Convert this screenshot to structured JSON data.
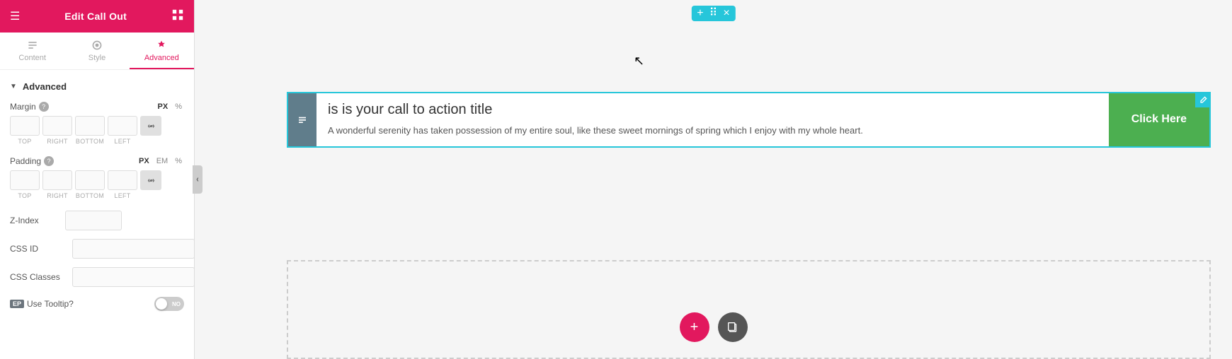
{
  "panel": {
    "header": {
      "title": "Edit Call Out",
      "hamburger": "☰",
      "grid": "⊞"
    },
    "tabs": [
      {
        "id": "content",
        "label": "Content",
        "icon": "content"
      },
      {
        "id": "style",
        "label": "Style",
        "icon": "style"
      },
      {
        "id": "advanced",
        "label": "Advanced",
        "icon": "advanced",
        "active": true
      }
    ],
    "advanced": {
      "section_title": "Advanced",
      "margin": {
        "label": "Margin",
        "units": [
          "PX",
          "%"
        ],
        "active_unit": "PX",
        "top": "",
        "right": "",
        "bottom": "",
        "left": "",
        "sub_labels": [
          "TOP",
          "RIGHT",
          "BOTTOM",
          "LEFT"
        ]
      },
      "padding": {
        "label": "Padding",
        "units": [
          "PX",
          "EM",
          "%"
        ],
        "active_unit": "PX",
        "top": "",
        "right": "",
        "bottom": "",
        "left": "",
        "sub_labels": [
          "TOP",
          "RIGHT",
          "BOTTOM",
          "LEFT"
        ]
      },
      "z_index": {
        "label": "Z-Index",
        "value": ""
      },
      "css_id": {
        "label": "CSS ID",
        "value": ""
      },
      "css_classes": {
        "label": "CSS Classes",
        "value": ""
      },
      "tooltip": {
        "ep_badge": "EP",
        "label": "Use Tooltip?",
        "toggle_state": "NO"
      }
    }
  },
  "canvas": {
    "toolbar": {
      "add": "+",
      "move": "⠿",
      "close": "×"
    },
    "callout": {
      "title": "is is your call to action title",
      "body": "A wonderful serenity has taken possession of my entire soul, like these sweet mornings of spring which I enjoy with my whole heart.",
      "button_text": "Click Here"
    },
    "cursor": "↖"
  },
  "bottom": {
    "add_label": "+",
    "copy_label": "❏"
  }
}
